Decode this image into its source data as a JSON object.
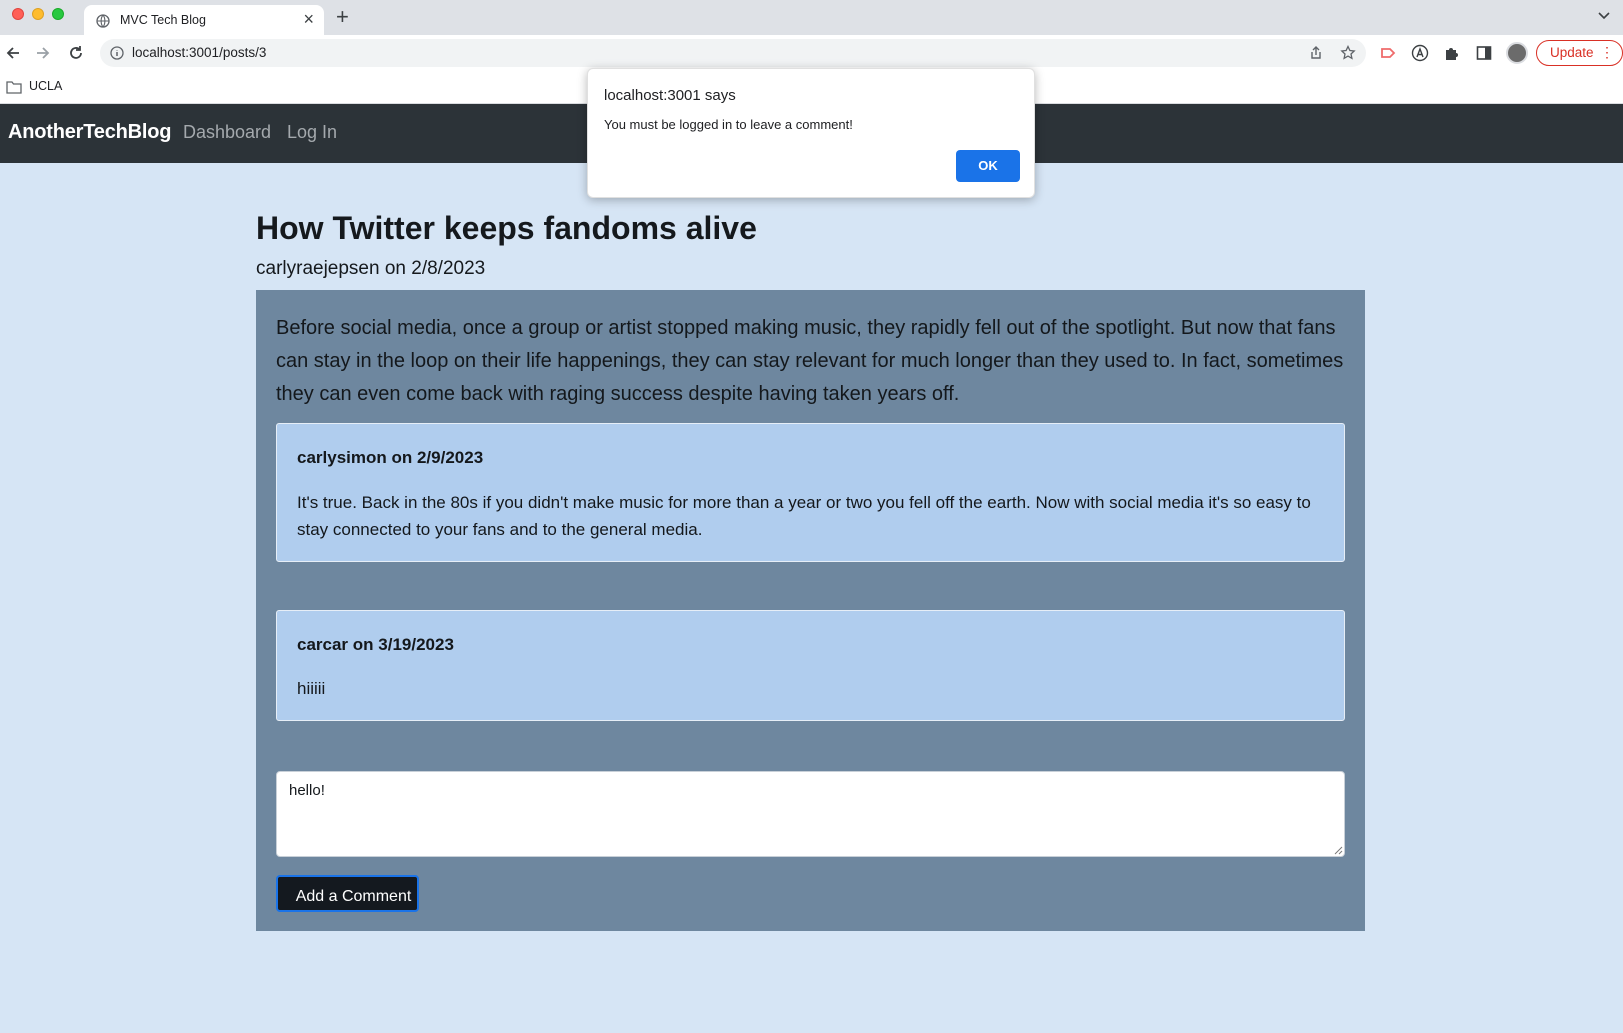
{
  "browser": {
    "tab_title": "MVC Tech Blog",
    "url": "localhost:3001/posts/3",
    "bookmark": "UCLA",
    "update_label": "Update"
  },
  "site": {
    "brand": "AnotherTechBlog",
    "nav": [
      "Dashboard",
      "Log In"
    ]
  },
  "post": {
    "title": "How Twitter keeps fandoms alive",
    "meta": "carlyraejepsen on 2/8/2023",
    "body": "Before social media, once a group or artist stopped making music, they rapidly fell out of the spotlight. But now that fans can stay in the loop on their life happenings, they can stay relevant for much longer than they used to. In fact, sometimes they can even come back with raging success despite having taken years off."
  },
  "comments": [
    {
      "meta": "carlysimon on 2/9/2023",
      "text": "It's true. Back in the 80s if you didn't make music for more than a year or two you fell off the earth. Now with social media it's so easy to stay connected to your fans and to the general media."
    },
    {
      "meta": "carcar on 3/19/2023",
      "text": "hiiiii"
    }
  ],
  "comment_form": {
    "value": "hello!",
    "button": "Add a Comment"
  },
  "alert": {
    "origin": "localhost:3001 says",
    "message": "You must be logged in to leave a comment!",
    "ok": "OK"
  }
}
